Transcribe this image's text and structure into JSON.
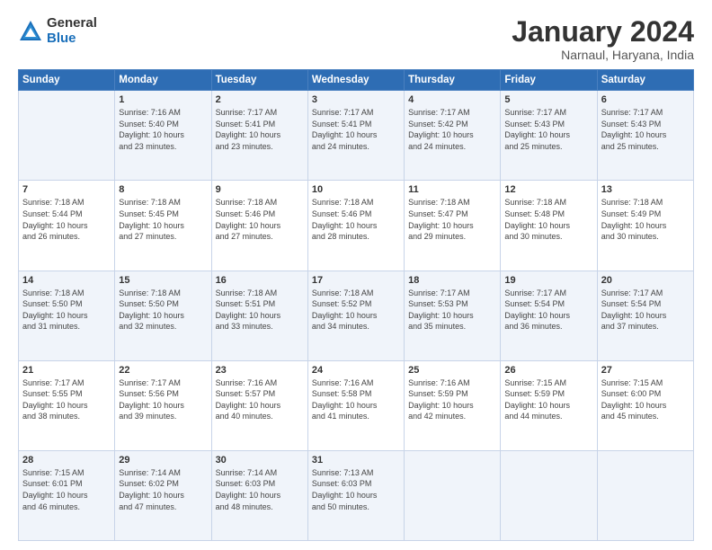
{
  "logo": {
    "general": "General",
    "blue": "Blue"
  },
  "title": "January 2024",
  "subtitle": "Narnaul, Haryana, India",
  "weekdays": [
    "Sunday",
    "Monday",
    "Tuesday",
    "Wednesday",
    "Thursday",
    "Friday",
    "Saturday"
  ],
  "weeks": [
    [
      {
        "day": "",
        "info": ""
      },
      {
        "day": "1",
        "info": "Sunrise: 7:16 AM\nSunset: 5:40 PM\nDaylight: 10 hours\nand 23 minutes."
      },
      {
        "day": "2",
        "info": "Sunrise: 7:17 AM\nSunset: 5:41 PM\nDaylight: 10 hours\nand 23 minutes."
      },
      {
        "day": "3",
        "info": "Sunrise: 7:17 AM\nSunset: 5:41 PM\nDaylight: 10 hours\nand 24 minutes."
      },
      {
        "day": "4",
        "info": "Sunrise: 7:17 AM\nSunset: 5:42 PM\nDaylight: 10 hours\nand 24 minutes."
      },
      {
        "day": "5",
        "info": "Sunrise: 7:17 AM\nSunset: 5:43 PM\nDaylight: 10 hours\nand 25 minutes."
      },
      {
        "day": "6",
        "info": "Sunrise: 7:17 AM\nSunset: 5:43 PM\nDaylight: 10 hours\nand 25 minutes."
      }
    ],
    [
      {
        "day": "7",
        "info": "Sunrise: 7:18 AM\nSunset: 5:44 PM\nDaylight: 10 hours\nand 26 minutes."
      },
      {
        "day": "8",
        "info": "Sunrise: 7:18 AM\nSunset: 5:45 PM\nDaylight: 10 hours\nand 27 minutes."
      },
      {
        "day": "9",
        "info": "Sunrise: 7:18 AM\nSunset: 5:46 PM\nDaylight: 10 hours\nand 27 minutes."
      },
      {
        "day": "10",
        "info": "Sunrise: 7:18 AM\nSunset: 5:46 PM\nDaylight: 10 hours\nand 28 minutes."
      },
      {
        "day": "11",
        "info": "Sunrise: 7:18 AM\nSunset: 5:47 PM\nDaylight: 10 hours\nand 29 minutes."
      },
      {
        "day": "12",
        "info": "Sunrise: 7:18 AM\nSunset: 5:48 PM\nDaylight: 10 hours\nand 30 minutes."
      },
      {
        "day": "13",
        "info": "Sunrise: 7:18 AM\nSunset: 5:49 PM\nDaylight: 10 hours\nand 30 minutes."
      }
    ],
    [
      {
        "day": "14",
        "info": "Sunrise: 7:18 AM\nSunset: 5:50 PM\nDaylight: 10 hours\nand 31 minutes."
      },
      {
        "day": "15",
        "info": "Sunrise: 7:18 AM\nSunset: 5:50 PM\nDaylight: 10 hours\nand 32 minutes."
      },
      {
        "day": "16",
        "info": "Sunrise: 7:18 AM\nSunset: 5:51 PM\nDaylight: 10 hours\nand 33 minutes."
      },
      {
        "day": "17",
        "info": "Sunrise: 7:18 AM\nSunset: 5:52 PM\nDaylight: 10 hours\nand 34 minutes."
      },
      {
        "day": "18",
        "info": "Sunrise: 7:17 AM\nSunset: 5:53 PM\nDaylight: 10 hours\nand 35 minutes."
      },
      {
        "day": "19",
        "info": "Sunrise: 7:17 AM\nSunset: 5:54 PM\nDaylight: 10 hours\nand 36 minutes."
      },
      {
        "day": "20",
        "info": "Sunrise: 7:17 AM\nSunset: 5:54 PM\nDaylight: 10 hours\nand 37 minutes."
      }
    ],
    [
      {
        "day": "21",
        "info": "Sunrise: 7:17 AM\nSunset: 5:55 PM\nDaylight: 10 hours\nand 38 minutes."
      },
      {
        "day": "22",
        "info": "Sunrise: 7:17 AM\nSunset: 5:56 PM\nDaylight: 10 hours\nand 39 minutes."
      },
      {
        "day": "23",
        "info": "Sunrise: 7:16 AM\nSunset: 5:57 PM\nDaylight: 10 hours\nand 40 minutes."
      },
      {
        "day": "24",
        "info": "Sunrise: 7:16 AM\nSunset: 5:58 PM\nDaylight: 10 hours\nand 41 minutes."
      },
      {
        "day": "25",
        "info": "Sunrise: 7:16 AM\nSunset: 5:59 PM\nDaylight: 10 hours\nand 42 minutes."
      },
      {
        "day": "26",
        "info": "Sunrise: 7:15 AM\nSunset: 5:59 PM\nDaylight: 10 hours\nand 44 minutes."
      },
      {
        "day": "27",
        "info": "Sunrise: 7:15 AM\nSunset: 6:00 PM\nDaylight: 10 hours\nand 45 minutes."
      }
    ],
    [
      {
        "day": "28",
        "info": "Sunrise: 7:15 AM\nSunset: 6:01 PM\nDaylight: 10 hours\nand 46 minutes."
      },
      {
        "day": "29",
        "info": "Sunrise: 7:14 AM\nSunset: 6:02 PM\nDaylight: 10 hours\nand 47 minutes."
      },
      {
        "day": "30",
        "info": "Sunrise: 7:14 AM\nSunset: 6:03 PM\nDaylight: 10 hours\nand 48 minutes."
      },
      {
        "day": "31",
        "info": "Sunrise: 7:13 AM\nSunset: 6:03 PM\nDaylight: 10 hours\nand 50 minutes."
      },
      {
        "day": "",
        "info": ""
      },
      {
        "day": "",
        "info": ""
      },
      {
        "day": "",
        "info": ""
      }
    ]
  ]
}
